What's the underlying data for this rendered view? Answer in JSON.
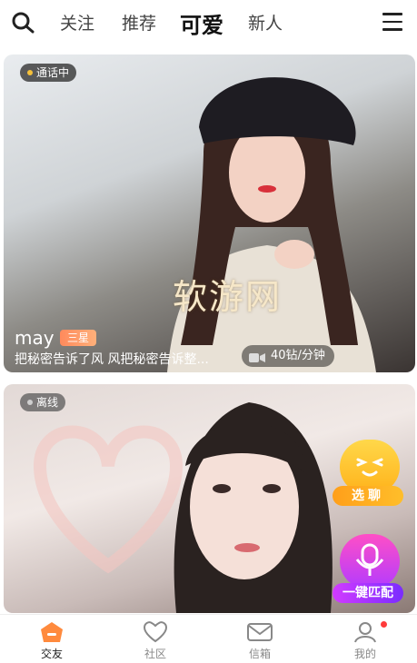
{
  "header": {
    "tabs": [
      {
        "label": "关注"
      },
      {
        "label": "推荐"
      },
      {
        "label": "可爱"
      },
      {
        "label": "新人"
      }
    ]
  },
  "cards": [
    {
      "status": "通话中",
      "name": "may",
      "badge": "三星",
      "description": "把秘密告诉了风 风把秘密告诉整...",
      "price": "40钻/分钟",
      "watermark": "软游网"
    },
    {
      "status": "离线"
    }
  ],
  "floating": {
    "select_chat": "选聊",
    "one_key_match": "一键匹配"
  },
  "bottom_nav": [
    {
      "label": "交友"
    },
    {
      "label": "社区"
    },
    {
      "label": "信箱"
    },
    {
      "label": "我的"
    }
  ],
  "colors": {
    "accent_orange": "#ff8a3d",
    "calling_dot": "#f5c03a",
    "notification_dot": "#ff3b3b"
  },
  "icons": [
    "search-icon",
    "menu-icon",
    "video-camera-icon",
    "friends-icon",
    "heart-icon",
    "mail-icon",
    "profile-icon"
  ]
}
